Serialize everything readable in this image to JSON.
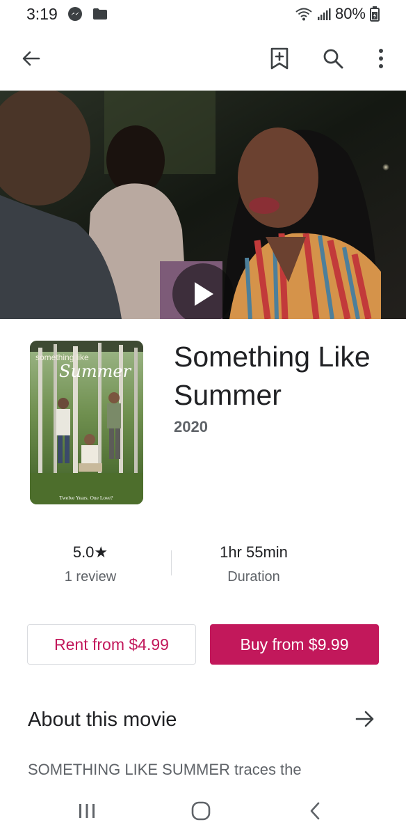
{
  "status_bar": {
    "time": "3:19",
    "battery": "80%",
    "icons": [
      "messenger-icon",
      "folder-icon",
      "wifi-icon",
      "signal-icon",
      "battery-icon"
    ]
  },
  "app_bar": {
    "icons": [
      "back-arrow-icon",
      "add-bookmark-icon",
      "search-icon",
      "more-vert-icon"
    ]
  },
  "movie": {
    "title": "Something Like Summer",
    "year": "2020",
    "poster_tagline": "Twelve Years. One Love?"
  },
  "stats": {
    "rating_value": "5.0",
    "rating_star": "★",
    "rating_label": "1 review",
    "duration_value": "1hr 55min",
    "duration_label": "Duration"
  },
  "actions": {
    "rent_label": "Rent from $4.99",
    "buy_label": "Buy from $9.99"
  },
  "about": {
    "title": "About this movie",
    "text": "SOMETHING LIKE SUMMER traces the"
  },
  "colors": {
    "accent": "#c2185b",
    "text_primary": "#202124",
    "text_secondary": "#5f6368"
  }
}
